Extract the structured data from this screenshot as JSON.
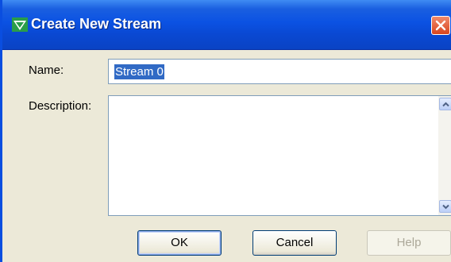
{
  "window": {
    "title": "Create New Stream",
    "title_icon": "stream-icon",
    "close_icon": "close-icon"
  },
  "form": {
    "name_label": "Name:",
    "name_value": "Stream 0",
    "description_label": "Description:",
    "description_value": ""
  },
  "buttons": {
    "ok": "OK",
    "cancel": "Cancel",
    "help": "Help"
  },
  "colors": {
    "titlebar": "#0a48d2",
    "selection": "#316ac5",
    "dialog_bg": "#ece9d8"
  }
}
